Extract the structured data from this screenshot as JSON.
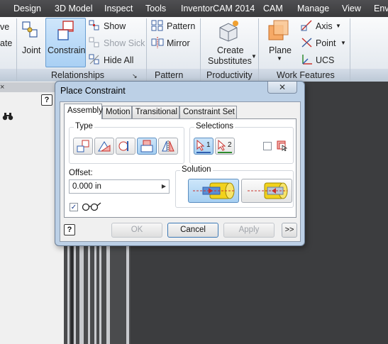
{
  "menubar": {
    "items": [
      "Design",
      "3D Model",
      "Inspect",
      "Tools",
      "InventorCAM 2014",
      "CAM",
      "Manage",
      "View",
      "Envi"
    ]
  },
  "ribbon": {
    "cut_left_top": "ve",
    "cut_left_bottom": "ate",
    "joint_label": "Joint",
    "constrain_label": "Constrain",
    "show_label": "Show",
    "show_sick_label": "Show Sick",
    "hide_all_label": "Hide All",
    "pattern_label": "Pattern",
    "mirror_label": "Mirror",
    "create_label": "Create",
    "substitutes_label": "Substitutes",
    "plane_label": "Plane",
    "axis_label": "Axis",
    "point_label": "Point",
    "ucs_label": "UCS",
    "panels": {
      "relationships": "Relationships",
      "pattern": "Pattern",
      "productivity": "Productivity",
      "work_features": "Work Features"
    }
  },
  "dialog": {
    "title": "Place Constraint",
    "close_glyph": "✕",
    "tabs": [
      "Assembly",
      "Motion",
      "Transitional",
      "Constraint Set"
    ],
    "type_label": "Type",
    "selections_label": "Selections",
    "selection1": "1",
    "selection2": "2",
    "offset_label": "Offset:",
    "offset_value": "0.000 in",
    "solution_label": "Solution",
    "help_glyph": "?",
    "buttons": {
      "ok": "OK",
      "cancel": "Cancel",
      "apply": "Apply",
      "more": ">>"
    },
    "preview_checked": true,
    "pick_first_checked": false
  },
  "browser": {
    "help_glyph": "?"
  }
}
